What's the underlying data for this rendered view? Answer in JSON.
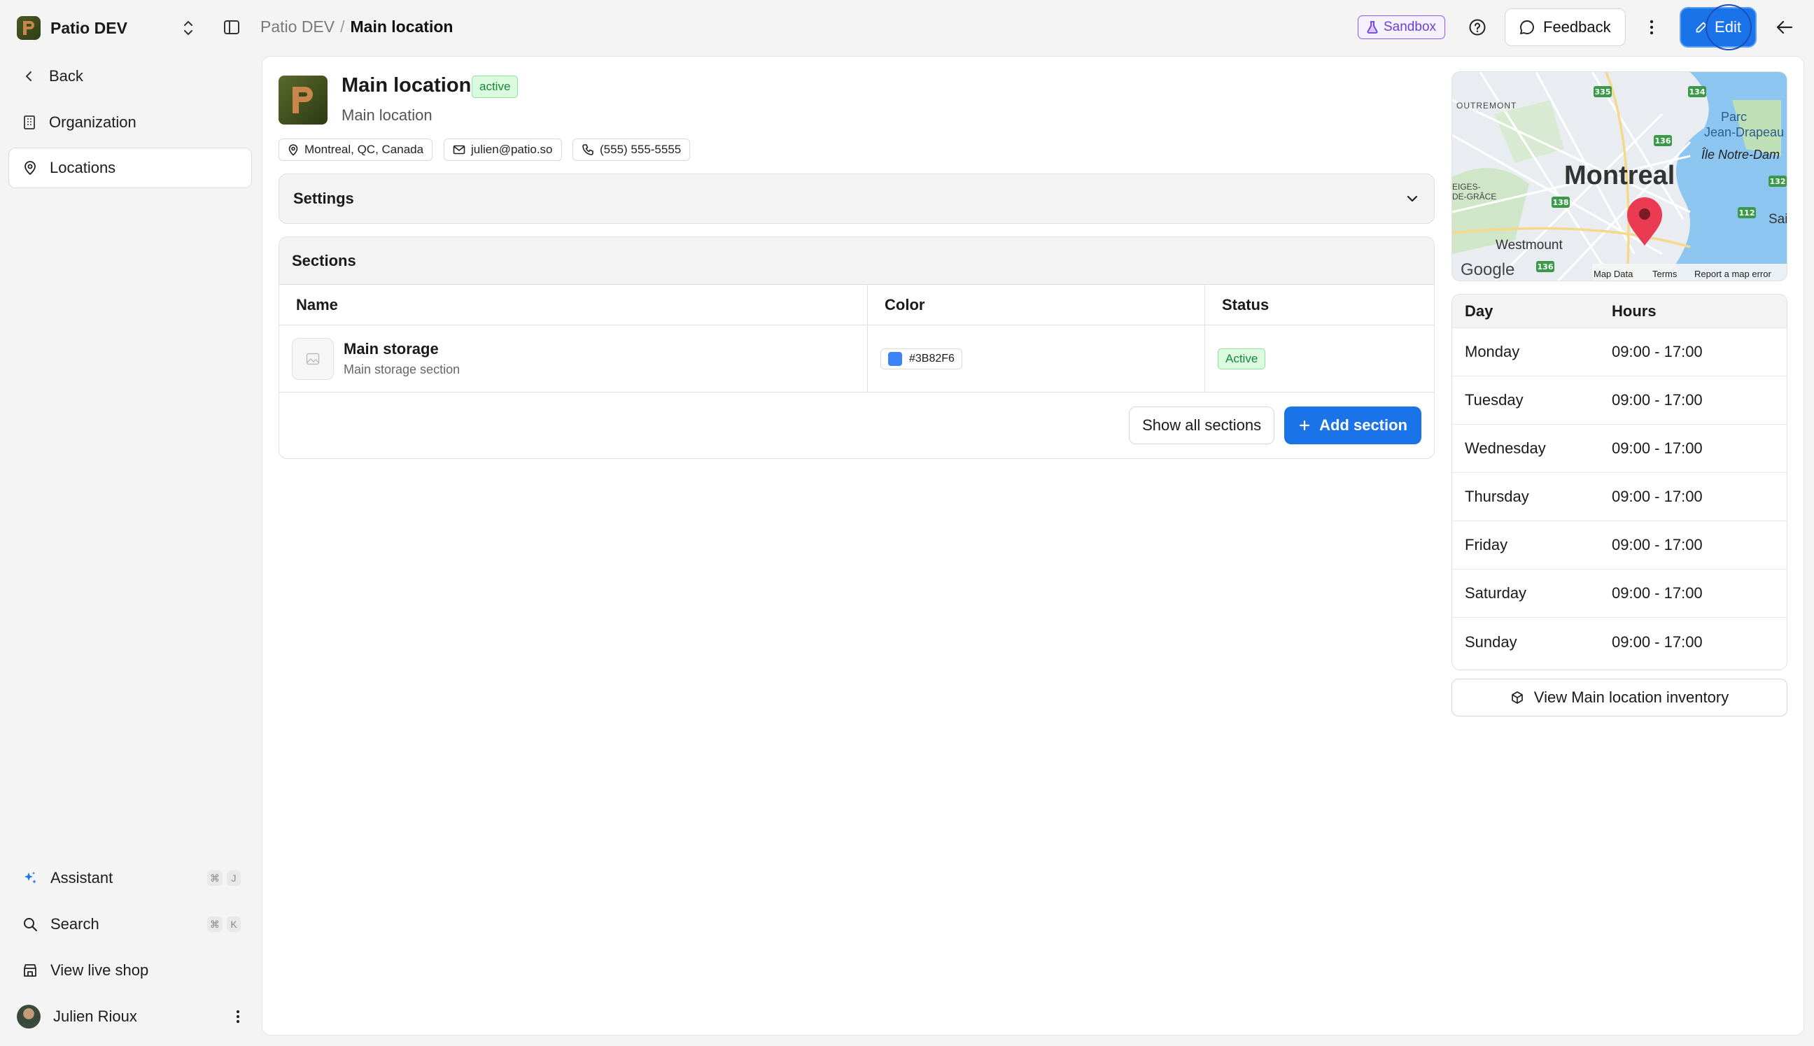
{
  "workspace": {
    "name": "Patio DEV",
    "logo_letter": "P"
  },
  "breadcrumb": {
    "parent": "Patio DEV",
    "separator": "/",
    "current": "Main location"
  },
  "topbar": {
    "sandbox_label": "Sandbox",
    "feedback_label": "Feedback",
    "edit_label": "Edit",
    "accent_color": "#1a73e8"
  },
  "sidebar": {
    "items": [
      {
        "label": "Back",
        "icon": "chevron-left-icon"
      },
      {
        "label": "Organization",
        "icon": "building-icon"
      },
      {
        "label": "Locations",
        "icon": "map-pin-icon",
        "active": true
      }
    ],
    "bottom": [
      {
        "label": "Assistant",
        "icon": "sparkle-icon",
        "shortcut": [
          "⌘",
          "J"
        ]
      },
      {
        "label": "Search",
        "icon": "search-icon",
        "shortcut": [
          "⌘",
          "K"
        ]
      },
      {
        "label": "View live shop",
        "icon": "store-icon"
      }
    ],
    "user": {
      "name": "Julien Rioux"
    }
  },
  "location": {
    "title": "Main location",
    "status": "active",
    "subtitle": "Main location",
    "address": "Montreal, QC, Canada",
    "email": "julien@patio.so",
    "phone": "(555) 555-5555"
  },
  "settings": {
    "title": "Settings"
  },
  "sections": {
    "title": "Sections",
    "columns": [
      "Name",
      "Color",
      "Status"
    ],
    "rows": [
      {
        "name": "Main storage",
        "description": "Main storage section",
        "color": "#3B82F6",
        "status": "Active"
      }
    ],
    "show_all_label": "Show all sections",
    "add_label": "Add section"
  },
  "map": {
    "city": "Montreal",
    "labels": [
      "OUTREMONT",
      "Parc",
      "Jean-Drapeau",
      "Île Notre-Dam",
      "Westmount",
      "EIGES-",
      "DE-GRÂCE",
      "Sai"
    ],
    "highway_labels": [
      "335",
      "134",
      "136",
      "132",
      "112",
      "138",
      "136"
    ],
    "attribution": {
      "logo": "Google",
      "map_data": "Map Data",
      "terms": "Terms",
      "report": "Report a map error"
    }
  },
  "hours": {
    "columns": [
      "Day",
      "Hours"
    ],
    "rows": [
      {
        "day": "Monday",
        "hours": "09:00 - 17:00"
      },
      {
        "day": "Tuesday",
        "hours": "09:00 - 17:00"
      },
      {
        "day": "Wednesday",
        "hours": "09:00 - 17:00"
      },
      {
        "day": "Thursday",
        "hours": "09:00 - 17:00"
      },
      {
        "day": "Friday",
        "hours": "09:00 - 17:00"
      },
      {
        "day": "Saturday",
        "hours": "09:00 - 17:00"
      },
      {
        "day": "Sunday",
        "hours": "09:00 - 17:00"
      }
    ]
  },
  "inventory_button": "View Main location inventory"
}
